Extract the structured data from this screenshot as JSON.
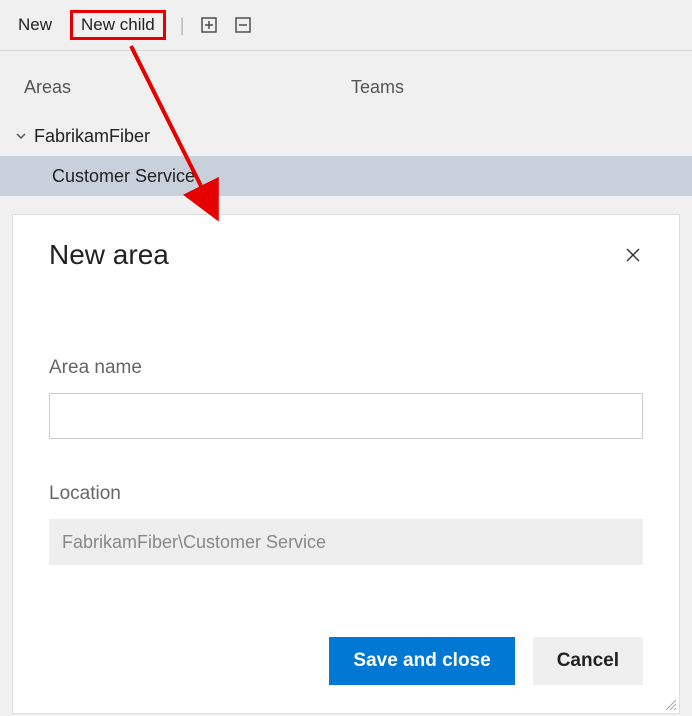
{
  "toolbar": {
    "new_label": "New",
    "new_child_label": "New child"
  },
  "tabs": {
    "areas_label": "Areas",
    "teams_label": "Teams"
  },
  "tree": {
    "root_label": "FabrikamFiber",
    "child_label": "Customer Service"
  },
  "dialog": {
    "title": "New area",
    "area_name_label": "Area name",
    "area_name_value": "",
    "location_label": "Location",
    "location_value": "FabrikamFiber\\Customer Service",
    "save_label": "Save and close",
    "cancel_label": "Cancel"
  }
}
